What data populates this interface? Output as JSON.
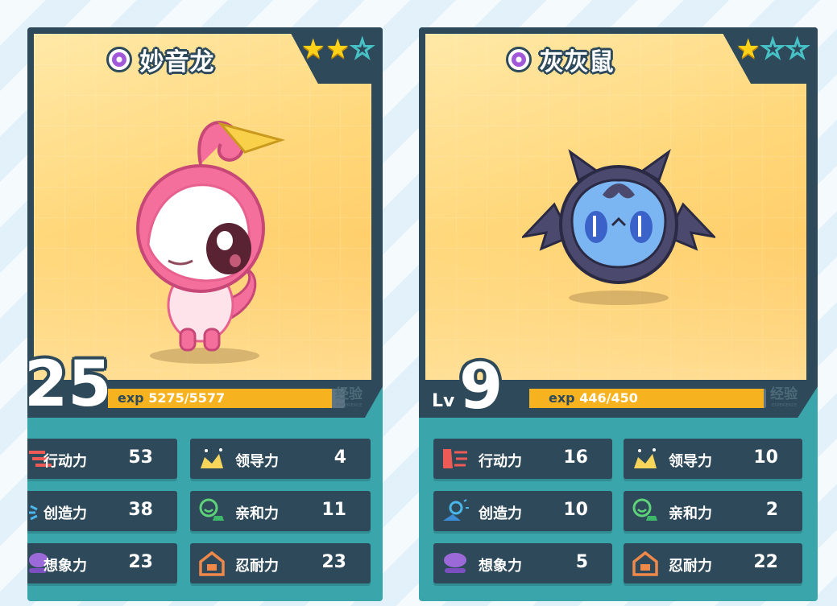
{
  "cards": [
    {
      "name": "妙音龙",
      "stars_filled": 2,
      "stars_total": 3,
      "level_prefix": "",
      "level": "25",
      "exp_prefix": "exp",
      "exp_current": "5275",
      "exp_sep": "/",
      "exp_max": "5577",
      "exp_fraction": 0.946,
      "exp_label": "经验",
      "exp_sublabel": "EXPERIENCE",
      "stats": [
        {
          "icon": "speed-icon",
          "label": "行动力",
          "value": "53"
        },
        {
          "icon": "leadership-icon",
          "label": "领导力",
          "value": "4"
        },
        {
          "icon": "creativity-icon",
          "label": "创造力",
          "value": "38"
        },
        {
          "icon": "affinity-icon",
          "label": "亲和力",
          "value": "11"
        },
        {
          "icon": "imagination-icon",
          "label": "想象力",
          "value": "23"
        },
        {
          "icon": "endurance-icon",
          "label": "忍耐力",
          "value": "23"
        }
      ]
    },
    {
      "name": "灰灰鼠",
      "stars_filled": 1,
      "stars_total": 3,
      "level_prefix": "Lv",
      "level": "9",
      "exp_prefix": "exp",
      "exp_current": "446",
      "exp_sep": "/",
      "exp_max": "450",
      "exp_fraction": 0.991,
      "exp_label": "经验",
      "exp_sublabel": "EXPERIENCE",
      "stats": [
        {
          "icon": "speed-icon",
          "label": "行动力",
          "value": "16"
        },
        {
          "icon": "leadership-icon",
          "label": "领导力",
          "value": "10"
        },
        {
          "icon": "creativity-icon",
          "label": "创造力",
          "value": "10"
        },
        {
          "icon": "affinity-icon",
          "label": "亲和力",
          "value": "2"
        },
        {
          "icon": "imagination-icon",
          "label": "想象力",
          "value": "5"
        },
        {
          "icon": "endurance-icon",
          "label": "忍耐力",
          "value": "22"
        }
      ]
    }
  ],
  "colors": {
    "frame": "#2e4a5a",
    "card_bg": "#3aa6ab",
    "exp_fill": "#f7b21f",
    "star_on": "#ffd21a"
  }
}
